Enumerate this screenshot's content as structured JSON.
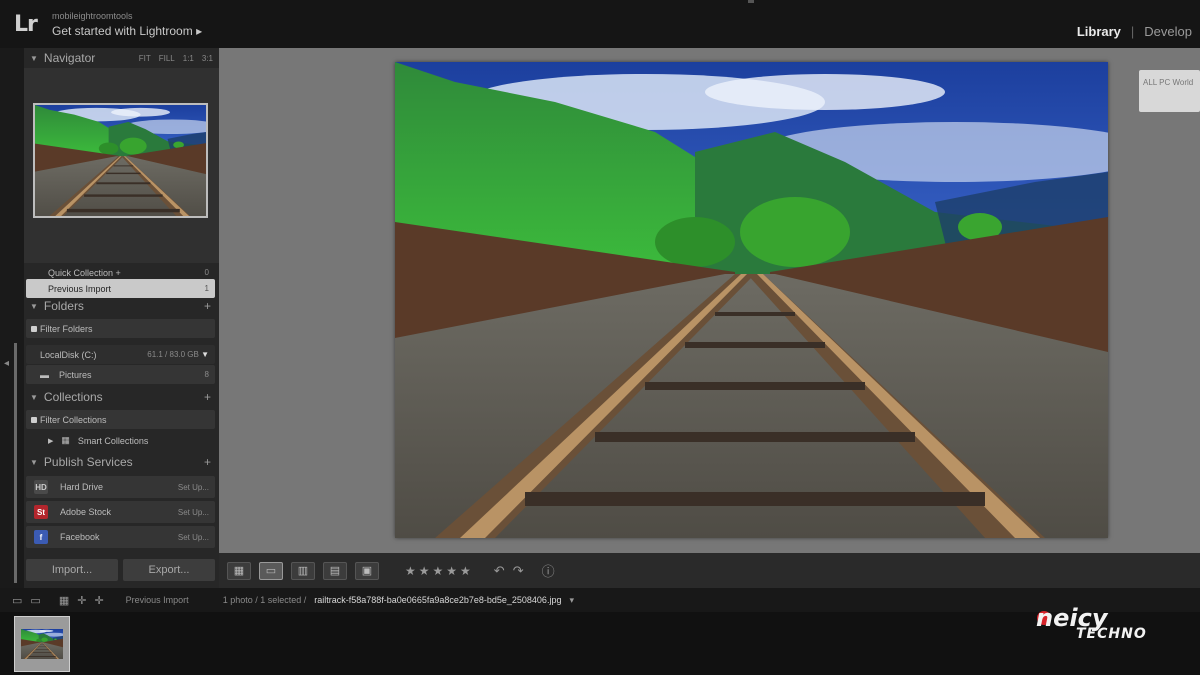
{
  "identity": {
    "small_text": "mobileightroomtools",
    "title": "Get started with Lightroom ▸",
    "logo": "Lr"
  },
  "modules": {
    "library": "Library",
    "separator": "|",
    "develop": "Develop"
  },
  "navigator": {
    "label": "Navigator",
    "zooms": [
      "FIT",
      "FILL",
      "1:1",
      "3:1"
    ]
  },
  "catalog": {
    "quick_collection": "Quick Collection +",
    "previous_import": "Previous Import"
  },
  "folders": {
    "label": "Folders",
    "filter_label": "Filter Folders",
    "volume_label": "LocalDisk (C:)",
    "volume_size": "61.1 / 83.0 GB",
    "pictures_label": "Pictures",
    "pictures_count": "8"
  },
  "collections": {
    "label": "Collections",
    "filter_label": "Filter Collections",
    "smart_label": "Smart Collections"
  },
  "publish": {
    "label": "Publish Services",
    "items": [
      {
        "name": "Hard Drive",
        "action": "Set Up...",
        "icon_label": "HD",
        "icon_color": "#4a4a4a"
      },
      {
        "name": "Adobe Stock",
        "action": "Set Up...",
        "icon_label": "St",
        "icon_color": "#b3262d"
      },
      {
        "name": "Facebook",
        "action": "Set Up...",
        "icon_label": "f",
        "icon_color": "#3b5bb3"
      }
    ]
  },
  "buttons": {
    "import": "Import...",
    "export": "Export..."
  },
  "toolbar": {
    "stars": "★★★★★"
  },
  "filmbar": {
    "source": "Previous Import",
    "count": "1 photo / 1 selected /",
    "filename": "railtrack-f58a788f-ba0e0665fa9a8ce2b7e8-bd5e_2508406.jpg",
    "caret": "▾"
  },
  "right_chip": {
    "text": "ALL PC World"
  },
  "brand": {
    "line1": "neicy",
    "line2": "TECHNO"
  },
  "colors": {
    "accent_dot": "#d6232a",
    "panel": "#272727",
    "canvas": "#777777"
  },
  "icons": {
    "grid": "grid-icon",
    "loupe": "loupe-icon",
    "compare": "compare-icon",
    "survey": "survey-icon",
    "people": "people-icon",
    "rotate_left": "rotate-left-icon",
    "rotate_right": "rotate-right-icon",
    "info": "info-icon"
  }
}
